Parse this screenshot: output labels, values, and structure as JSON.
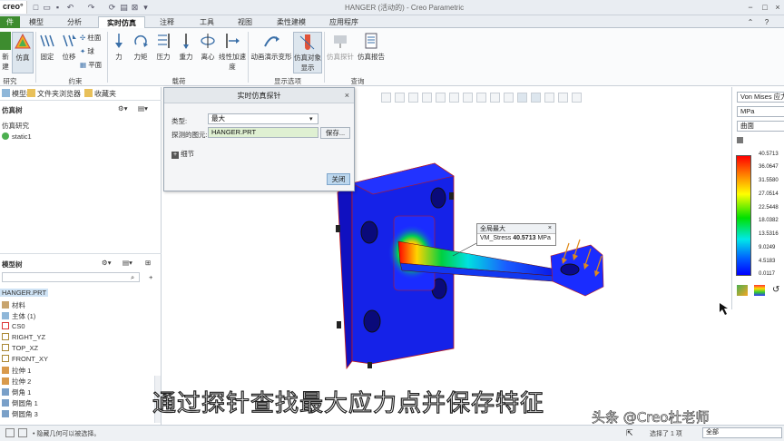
{
  "app": {
    "logo": "creo°",
    "window_title": "HANGER (活动的) - Creo Parametric"
  },
  "tabs": [
    {
      "label": "件",
      "active": false
    },
    {
      "label": "模型",
      "active": false
    },
    {
      "label": "分析",
      "active": false
    },
    {
      "label": "实时仿真",
      "active": true
    },
    {
      "label": "注释",
      "active": false
    },
    {
      "label": "工具",
      "active": false
    },
    {
      "label": "视图",
      "active": false
    },
    {
      "label": "柔性建模",
      "active": false
    },
    {
      "label": "应用程序",
      "active": false
    }
  ],
  "ribbon": {
    "buttons": {
      "new": "新建",
      "sim": "仿真",
      "fix": "固定",
      "disp": "位移",
      "cyl": "柱面",
      "ball": "球",
      "plane": "平面",
      "force": "力",
      "moment": "力矩",
      "pressure": "压力",
      "gravity": "重力",
      "centrifugal": "离心",
      "linacc_1": "线性加速",
      "linacc_2": "度",
      "anim_1": "动画演示变形",
      "simdisp_1": "仿真对象",
      "simdisp_2": "显示",
      "probe": "仿真探针",
      "report": "仿真报告"
    },
    "groups": {
      "study": "研究",
      "constraint": "约束",
      "load": "载荷",
      "display": "显示选项",
      "query": "查询"
    }
  },
  "left_pane": {
    "tabs": [
      "模型树",
      "文件夹浏览器",
      "收藏夹"
    ],
    "sim_tree": {
      "header": "仿真树",
      "root": "仿真研究",
      "child": "static1"
    },
    "model_tree": {
      "header": "模型树",
      "items": [
        "HANGER.PRT",
        "材料",
        "主体 (1)",
        "CS0",
        "RIGHT_YZ",
        "TOP_XZ",
        "FRONT_XY",
        "拉伸 1",
        "拉伸 2",
        "倒角 1",
        "倒圆角 1",
        "倒圆角 3"
      ]
    }
  },
  "dialog": {
    "title": "实时仿真探针",
    "type_label": "类型:",
    "type_value": "最大",
    "entity_label": "探测的图元:",
    "entity_value": "HANGER.PRT",
    "save_label": "保存...",
    "details_label": "细节",
    "close_label": "关闭"
  },
  "probe": {
    "title": "全局最大",
    "quantity": "VM_Stress",
    "value": "40.5713",
    "unit": "MPa"
  },
  "legend": {
    "quantity": "Von Mises 应力",
    "unit": "MPa",
    "display": "曲面",
    "values": [
      "40.5713",
      "36.0647",
      "31.5580",
      "27.0514",
      "22.5448",
      "18.0382",
      "13.5316",
      "9.0249",
      "4.5183",
      "0.0117"
    ]
  },
  "status": {
    "message": "• 隐藏几何可以被选择。",
    "selection": "选择了 1 项",
    "filter": "全部"
  },
  "overlay": {
    "caption": "通过探针查找最大应力点并保存特征",
    "watermark": "头条 @Creo杜老师"
  }
}
